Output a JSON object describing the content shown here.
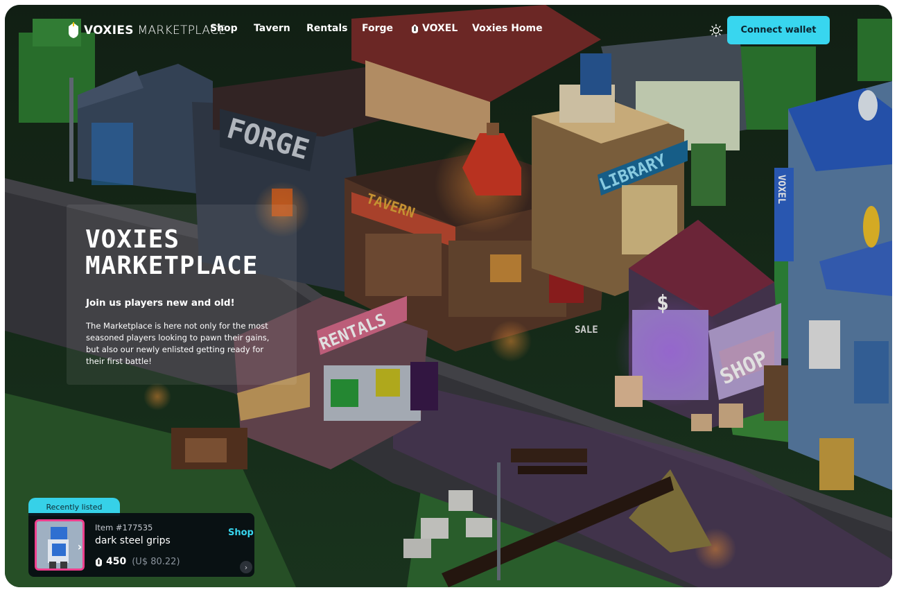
{
  "brand": {
    "name_bold": "VOXIES",
    "name_light": "MARKETPLACE"
  },
  "nav": {
    "links": [
      "Shop",
      "Tavern",
      "Rentals",
      "Forge",
      "VOXEL",
      "Voxies Home"
    ],
    "connect_label": "Connect wallet"
  },
  "scene": {
    "signs": {
      "forge": "FORGE",
      "tavern": "TAVERN",
      "library": "LIBRARY",
      "rentals": "RENTALS",
      "shop": "SHOP",
      "sale": "SALE",
      "voxel": "VOXEL",
      "dollar": "$"
    }
  },
  "hero": {
    "title_line1": "VOXIES",
    "title_line2": "MARKETPLACE",
    "subtitle": "Join us players new and old!",
    "body": "The Marketplace is here not only for the most seasoned players looking to pawn their gains, but also our newly enlisted getting ready for their first battle!"
  },
  "recent": {
    "tab_label": "Recently listed",
    "item_id": "Item #177535",
    "item_name": "dark steel grips",
    "shop_label": "Shop",
    "price": "450",
    "price_usd": "(U$ 80.22)"
  },
  "colors": {
    "accent": "#38d6ef",
    "thumb_border": "#ee3f8d"
  },
  "icons": [
    "voxies-logo-icon",
    "voxel-token-icon",
    "sun-icon",
    "chevron-right-icon"
  ]
}
